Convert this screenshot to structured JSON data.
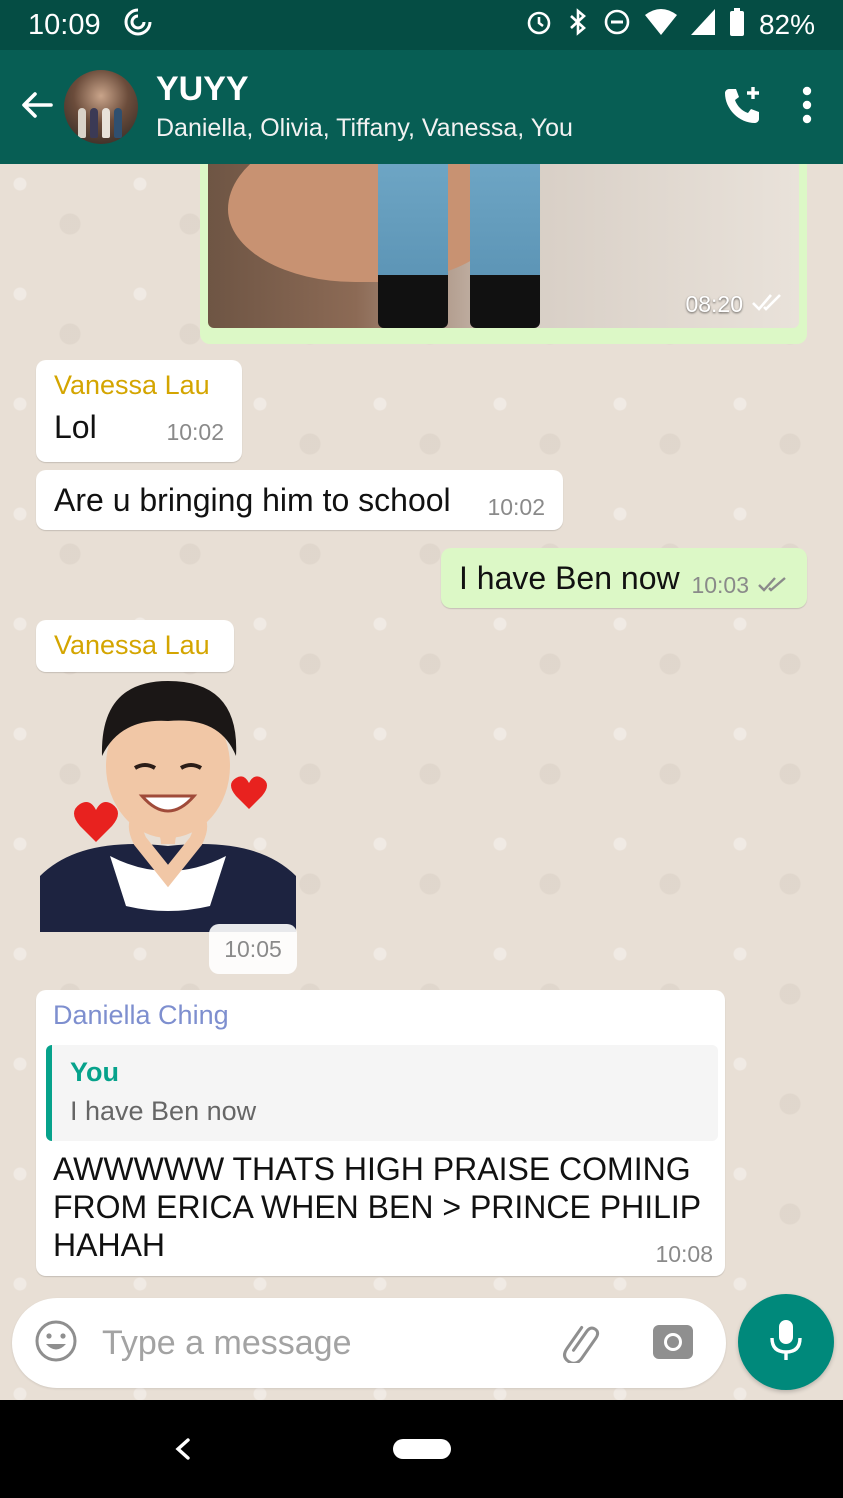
{
  "status_bar": {
    "time": "10:09",
    "battery": "82%"
  },
  "header": {
    "title": "YUYY",
    "members": "Daniella, Olivia, Tiffany, Vanessa, You"
  },
  "messages": {
    "image": {
      "time": "08:20"
    },
    "m1": {
      "sender": "Vanessa Lau",
      "text": "Lol",
      "time": "10:02"
    },
    "m2": {
      "text": "Are u bringing him to school",
      "time": "10:02"
    },
    "m3": {
      "text": "I have Ben now",
      "time": "10:03"
    },
    "m4": {
      "sender": "Vanessa Lau",
      "time": "10:05"
    },
    "m5": {
      "sender": "Daniella Ching",
      "quote_author": "You",
      "quote_text": "I have Ben now",
      "line1": "AWWWWW THATS HIGH PRAISE COMING",
      "line2": "FROM ERICA WHEN BEN > PRINCE PHILIP",
      "line3": "HAHAH",
      "time": "10:08"
    }
  },
  "input": {
    "placeholder": "Type a message"
  },
  "colors": {
    "appbar": "#075e54",
    "statusbar": "#054d44",
    "outgoing_bubble": "#dcf8c6",
    "sender_vanessa": "#d4a500",
    "sender_daniella": "#7e8fcf",
    "accent": "#00897b"
  }
}
